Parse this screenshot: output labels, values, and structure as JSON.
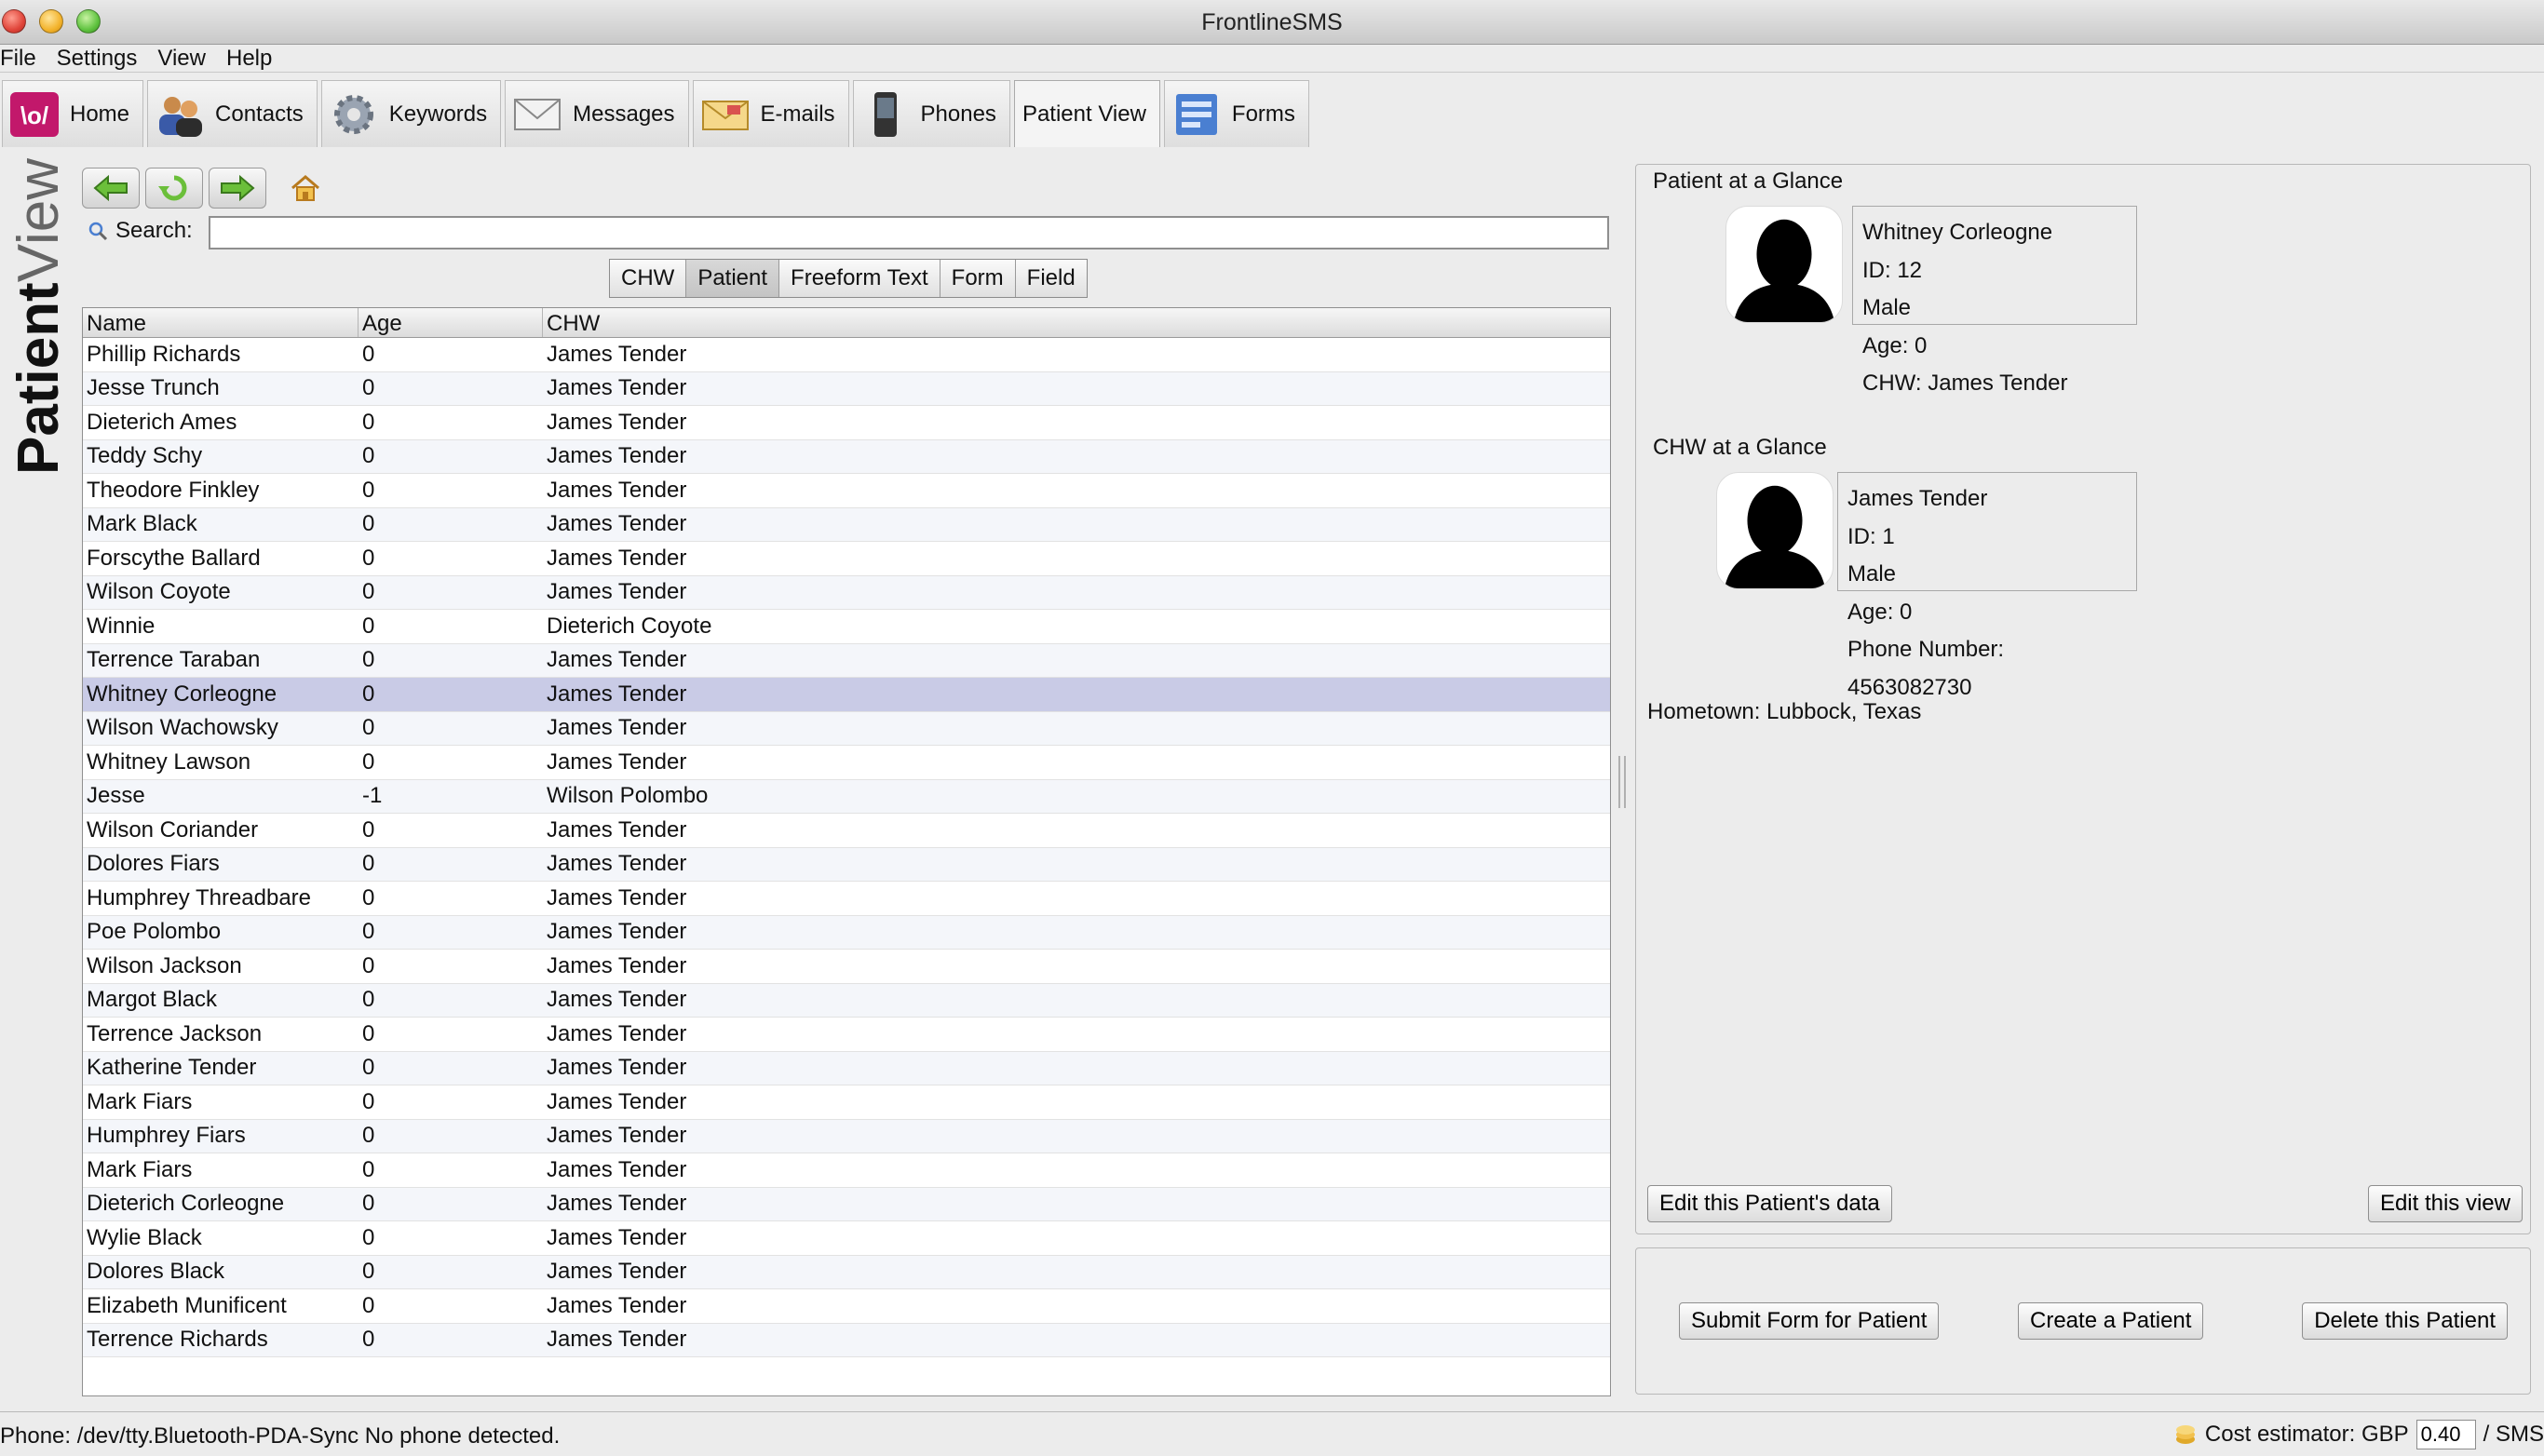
{
  "window": {
    "title": "FrontlineSMS"
  },
  "menu": [
    "File",
    "Settings",
    "View",
    "Help"
  ],
  "tabs": [
    {
      "label": "Home",
      "icon": "frontline-logo-icon",
      "active": false
    },
    {
      "label": "Contacts",
      "icon": "contacts-icon",
      "active": false
    },
    {
      "label": "Keywords",
      "icon": "gear-icon",
      "active": false
    },
    {
      "label": "Messages",
      "icon": "envelope-icon",
      "active": false
    },
    {
      "label": "E-mails",
      "icon": "email-icon",
      "active": false
    },
    {
      "label": "Phones",
      "icon": "phone-icon",
      "active": false
    },
    {
      "label": "Patient View",
      "icon": "",
      "active": true
    },
    {
      "label": "Forms",
      "icon": "form-icon",
      "active": false
    }
  ],
  "banner": {
    "bold": "Patient",
    "light": "View"
  },
  "search": {
    "label": "Search:",
    "value": ""
  },
  "filters": [
    {
      "label": "CHW",
      "active": false
    },
    {
      "label": "Patient",
      "active": true
    },
    {
      "label": "Freeform Text",
      "active": false
    },
    {
      "label": "Form",
      "active": false
    },
    {
      "label": "Field",
      "active": false
    }
  ],
  "table": {
    "columns": [
      "Name",
      "Age",
      "CHW"
    ],
    "selected_index": 10,
    "rows": [
      [
        "Phillip Richards",
        "0",
        "James Tender"
      ],
      [
        "Jesse Trunch",
        "0",
        "James Tender"
      ],
      [
        "Dieterich Ames",
        "0",
        "James Tender"
      ],
      [
        "Teddy Schy",
        "0",
        "James Tender"
      ],
      [
        "Theodore Finkley",
        "0",
        "James Tender"
      ],
      [
        "Mark Black",
        "0",
        "James Tender"
      ],
      [
        "Forscythe Ballard",
        "0",
        "James Tender"
      ],
      [
        "Wilson Coyote",
        "0",
        "James Tender"
      ],
      [
        "Winnie",
        "0",
        "Dieterich Coyote"
      ],
      [
        "Terrence Taraban",
        "0",
        "James Tender"
      ],
      [
        "Whitney Corleogne",
        "0",
        "James Tender"
      ],
      [
        "Wilson Wachowsky",
        "0",
        "James Tender"
      ],
      [
        "Whitney Lawson",
        "0",
        "James Tender"
      ],
      [
        "Jesse",
        "-1",
        "Wilson Polombo"
      ],
      [
        "Wilson Coriander",
        "0",
        "James Tender"
      ],
      [
        "Dolores Fiars",
        "0",
        "James Tender"
      ],
      [
        "Humphrey Threadbare",
        "0",
        "James Tender"
      ],
      [
        "Poe Polombo",
        "0",
        "James Tender"
      ],
      [
        "Wilson Jackson",
        "0",
        "James Tender"
      ],
      [
        "Margot Black",
        "0",
        "James Tender"
      ],
      [
        "Terrence Jackson",
        "0",
        "James Tender"
      ],
      [
        "Katherine Tender",
        "0",
        "James Tender"
      ],
      [
        "Mark Fiars",
        "0",
        "James Tender"
      ],
      [
        "Humphrey Fiars",
        "0",
        "James Tender"
      ],
      [
        "Mark Fiars",
        "0",
        "James Tender"
      ],
      [
        "Dieterich Corleogne",
        "0",
        "James Tender"
      ],
      [
        "Wylie Black",
        "0",
        "James Tender"
      ],
      [
        "Dolores Black",
        "0",
        "James Tender"
      ],
      [
        "Elizabeth Munificent",
        "0",
        "James Tender"
      ],
      [
        "Terrence Richards",
        "0",
        "James Tender"
      ]
    ]
  },
  "patient_glance": {
    "heading": "Patient at a Glance",
    "lines": [
      "Whitney Corleogne",
      "ID: 12",
      "Male",
      "Age: 0",
      "CHW: James Tender"
    ]
  },
  "chw_glance": {
    "heading": "CHW at a Glance",
    "lines": [
      "James Tender",
      "ID: 1",
      "Male",
      "Age: 0",
      "Phone Number: 4563082730"
    ]
  },
  "hometown": "Hometown: Lubbock, Texas",
  "buttons": {
    "edit_patient": "Edit this Patient's data",
    "edit_view": "Edit this view",
    "submit_form": "Submit Form for Patient",
    "create_patient": "Create a Patient",
    "delete_patient": "Delete this Patient"
  },
  "status": {
    "phone": "Phone: /dev/tty.Bluetooth-PDA-Sync No phone detected.",
    "cost_label": "Cost estimator: GBP",
    "cost_value": "0.40",
    "cost_suffix": "/ SMS"
  },
  "colors": {
    "selected_row": "#c9cbe6",
    "home_logo": "#c2186b"
  }
}
